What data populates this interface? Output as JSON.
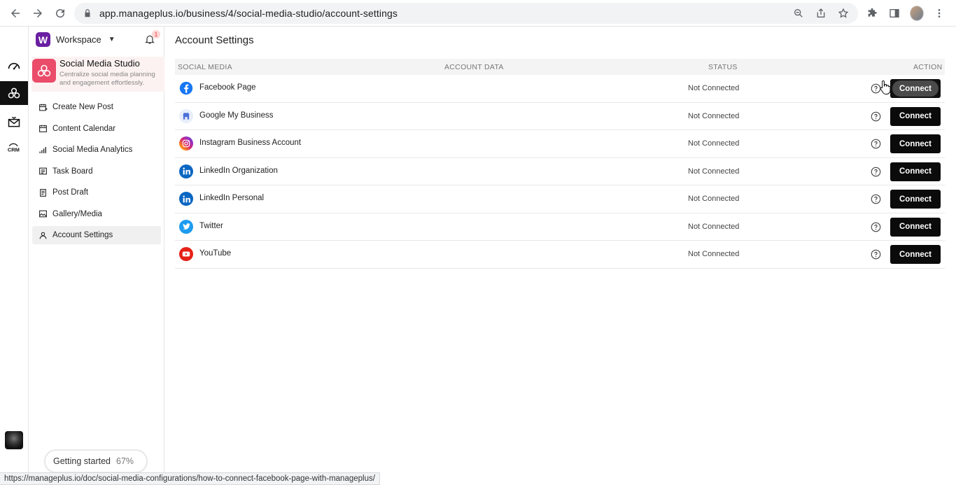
{
  "browser": {
    "url": "app.manageplus.io/business/4/social-media-studio/account-settings",
    "status_url": "https://manageplus.io/doc/social-media-configurations/how-to-connect-facebook-page-with-manageplus/"
  },
  "workspace": {
    "logo_letter": "W",
    "label": "Workspace",
    "notification_count": "1"
  },
  "app": {
    "name": "Social Media Studio",
    "description": "Centralize social media planning and engagement effortlessly."
  },
  "rail": {
    "items": [
      {
        "icon": "dashboard-gauge-icon"
      },
      {
        "icon": "social-studio-icon",
        "active": true
      },
      {
        "icon": "email-campaign-icon"
      },
      {
        "icon": "crm-icon",
        "label": "CRM"
      }
    ]
  },
  "menu": {
    "items": [
      {
        "label": "Create New Post",
        "icon": "create-post-icon"
      },
      {
        "label": "Content Calendar",
        "icon": "calendar-icon"
      },
      {
        "label": "Social Media Analytics",
        "icon": "analytics-icon"
      },
      {
        "label": "Task Board",
        "icon": "task-board-icon"
      },
      {
        "label": "Post Draft",
        "icon": "draft-icon"
      },
      {
        "label": "Gallery/Media",
        "icon": "gallery-icon"
      },
      {
        "label": "Account Settings",
        "icon": "user-icon",
        "active": true
      }
    ]
  },
  "getting_started": {
    "label": "Getting started",
    "percent": "67%"
  },
  "page": {
    "title": "Account Settings"
  },
  "table": {
    "headers": {
      "social_media": "SOCIAL MEDIA",
      "account_data": "ACCOUNT DATA",
      "status": "STATUS",
      "action": "ACTION"
    },
    "rows": [
      {
        "name": "Facebook Page",
        "status": "Not Connected",
        "action": "Connect",
        "icon": "facebook-icon",
        "color": "#1877f2"
      },
      {
        "name": "Google My Business",
        "status": "Not Connected",
        "action": "Connect",
        "icon": "google-my-business-icon",
        "color": "#4a6fd8"
      },
      {
        "name": "Instagram Business Account",
        "status": "Not Connected",
        "action": "Connect",
        "icon": "instagram-icon",
        "color": "#d62976"
      },
      {
        "name": "LinkedIn Organization",
        "status": "Not Connected",
        "action": "Connect",
        "icon": "linkedin-icon",
        "color": "#0a66c2"
      },
      {
        "name": "LinkedIn Personal",
        "status": "Not Connected",
        "action": "Connect",
        "icon": "linkedin-icon",
        "color": "#0a66c2"
      },
      {
        "name": "Twitter",
        "status": "Not Connected",
        "action": "Connect",
        "icon": "twitter-icon",
        "color": "#1d9bf0"
      },
      {
        "name": "YouTube",
        "status": "Not Connected",
        "action": "Connect",
        "icon": "youtube-icon",
        "color": "#e62117"
      }
    ]
  }
}
